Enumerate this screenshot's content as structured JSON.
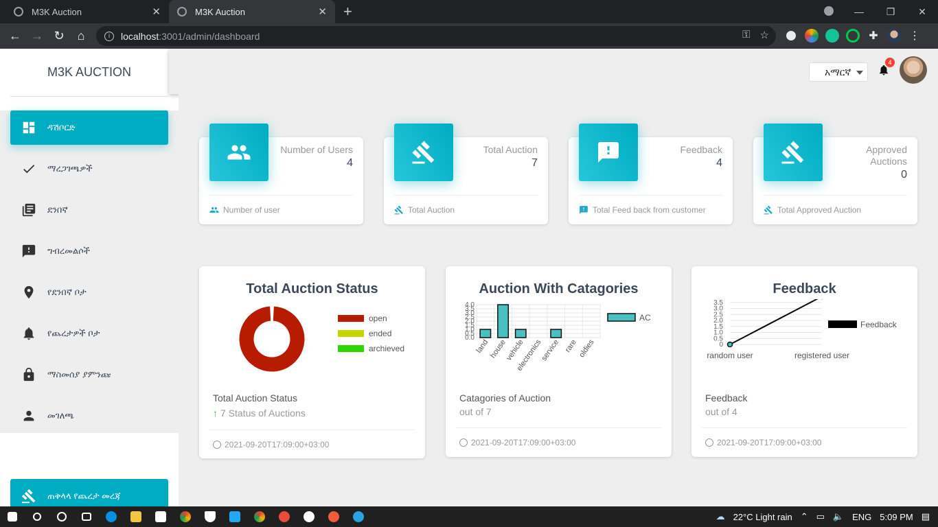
{
  "browser": {
    "tabs": [
      {
        "title": "M3K Auction"
      },
      {
        "title": "M3K Auction"
      }
    ],
    "new_tab": "+",
    "url_host": "localhost",
    "url_path": ":3001/admin/dashboard",
    "window_controls": {
      "minimize": "—",
      "restore": "❐",
      "close": "✕"
    }
  },
  "app": {
    "brand": "M3K AUCTION",
    "language": "አማርኛ",
    "notifications_count": "4",
    "sidebar": {
      "items": [
        {
          "label": "ዳሽቦርድ",
          "icon": "dashboard-icon",
          "active": true
        },
        {
          "label": "ማረጋገጫዎች",
          "icon": "check-icon"
        },
        {
          "label": "ደንበኛ",
          "icon": "library-books-icon"
        },
        {
          "label": "ግብረመልሶች",
          "icon": "feedback-icon"
        },
        {
          "label": "የደንበኛ ቦታ",
          "icon": "location-pin-icon"
        },
        {
          "label": "የጨረታዎች ቦታ",
          "icon": "bell-icon"
        },
        {
          "label": "ማስመሰያ ያምንጩ",
          "icon": "lock-icon"
        },
        {
          "label": "መገለጫ",
          "icon": "person-icon"
        }
      ],
      "bottom": {
        "label": "ጠቅላላ የጨረታ መረጃ",
        "icon": "gavel-icon"
      }
    },
    "stats": [
      {
        "title": "Number of Users",
        "value": "4",
        "footer": "Number of user",
        "icon": "people-icon"
      },
      {
        "title": "Total Auction",
        "value": "7",
        "footer": "Total Auction",
        "icon": "gavel-icon"
      },
      {
        "title": "Feedback",
        "value": "4",
        "footer": "Total Feed back from customer",
        "icon": "feedback-icon"
      },
      {
        "title": "Approved Auctions",
        "value": "0",
        "footer": "Total Approved Auction",
        "icon": "gavel-icon"
      }
    ],
    "charts": {
      "status": {
        "title": "Total Auction Status",
        "sub": "Total Auction Status",
        "sub2": "7 Status of Auctions",
        "time": "2021-09-20T17:09:00+03:00"
      },
      "categories": {
        "title": "Auction With Catagories",
        "sub": "Catagories of Auction",
        "sub2": "out of 7",
        "time": "2021-09-20T17:09:00+03:00"
      },
      "feedback": {
        "title": "Feedback",
        "sub": "Feedback",
        "sub2": "out of 4",
        "time": "2021-09-20T17:09:00+03:00"
      }
    }
  },
  "chart_data": [
    {
      "type": "pie",
      "title": "Total Auction Status",
      "categories": [
        "open",
        "ended",
        "archieved"
      ],
      "values": [
        7,
        0,
        0
      ],
      "colors": [
        "#b71c00",
        "#c6d400",
        "#2ed600"
      ],
      "legend": "right"
    },
    {
      "type": "bar",
      "title": "Auction With Catagories",
      "categories": [
        "land",
        "house",
        "vehicle",
        "electronics",
        "service",
        "rare",
        "oldies"
      ],
      "series": [
        {
          "name": "AC",
          "values": [
            1,
            4,
            1,
            0,
            1,
            0,
            0
          ]
        }
      ],
      "ylim": [
        0,
        4
      ],
      "yticks": [
        "0.0",
        "0.5",
        "1.0",
        "1.5",
        "2.0",
        "2.5",
        "3.0",
        "3.5",
        "4.0"
      ],
      "color": "#4bc0c0",
      "legend": "right"
    },
    {
      "type": "line",
      "title": "Feedback",
      "categories": [
        "random user",
        "registered user"
      ],
      "series": [
        {
          "name": "Feedback",
          "values": [
            0,
            4
          ]
        }
      ],
      "ylim": [
        0,
        4
      ],
      "yticks": [
        "0",
        "0.5",
        "1.0",
        "1.5",
        "2.0",
        "2.5",
        "3.0",
        "3.5",
        "4.0"
      ],
      "color": "#000000",
      "legend": "right"
    }
  ],
  "taskbar": {
    "weather": "22°C  Light rain",
    "lang": "ENG",
    "time": "5:09 PM"
  }
}
